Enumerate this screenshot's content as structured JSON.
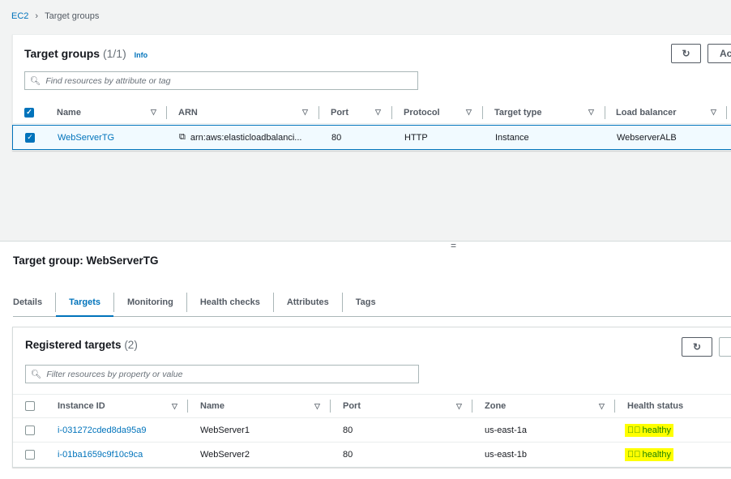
{
  "breadcrumb": {
    "root": "EC2",
    "current": "Target groups"
  },
  "target_groups": {
    "title": "Target groups",
    "count": "(1/1)",
    "info": "Info",
    "actions_label": "Act",
    "search_placeholder": "Find resources by attribute or tag",
    "columns": [
      "Name",
      "ARN",
      "Port",
      "Protocol",
      "Target type",
      "Load balancer"
    ],
    "rows": [
      {
        "name": "WebServerTG",
        "arn": "arn:aws:elasticloadbalanci...",
        "port": "80",
        "protocol": "HTTP",
        "target_type": "Instance",
        "load_balancer": "WebserverALB",
        "selected": true
      }
    ]
  },
  "resize_handle": "=",
  "detail": {
    "title": "Target group: WebServerTG",
    "tabs": [
      {
        "label": "Details"
      },
      {
        "label": "Targets",
        "active": true
      },
      {
        "label": "Monitoring"
      },
      {
        "label": "Health checks"
      },
      {
        "label": "Attributes"
      },
      {
        "label": "Tags"
      }
    ]
  },
  "registered": {
    "title": "Registered targets",
    "count": "(2)",
    "search_placeholder": "Filter resources by property or value",
    "columns": [
      "Instance ID",
      "Name",
      "Port",
      "Zone",
      "Health status"
    ],
    "rows": [
      {
        "id": "i-031272cded8da95a9",
        "name": "WebServer1",
        "port": "80",
        "zone": "us-east-1a",
        "health": "healthy"
      },
      {
        "id": "i-01ba1659c9f10c9ca",
        "name": "WebServer2",
        "port": "80",
        "zone": "us-east-1b",
        "health": "healthy"
      }
    ]
  },
  "colors": {
    "link": "#0073bb",
    "healthy": "#1d8102",
    "highlight": "#ffff00"
  }
}
